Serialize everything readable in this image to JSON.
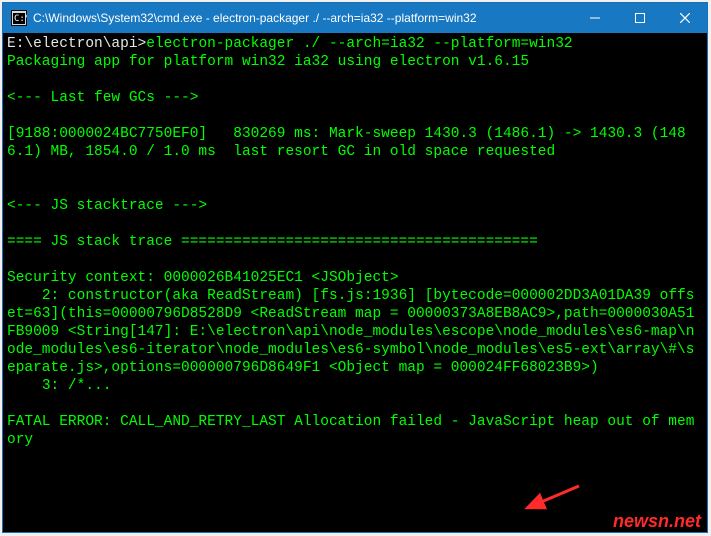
{
  "window": {
    "title": "C:\\Windows\\System32\\cmd.exe - electron-packager  ./  --arch=ia32 --platform=win32"
  },
  "terminal": {
    "prompt_path": "E:\\electron\\api>",
    "command": "electron-packager ./ --arch=ia32 --platform=win32",
    "lines": [
      "Packaging app for platform win32 ia32 using electron v1.6.15",
      "",
      "<--- Last few GCs --->",
      "",
      "[9188:0000024BC7750EF0]   830269 ms: Mark-sweep 1430.3 (1486.1) -> 1430.3 (1486.1) MB, 1854.0 / 1.0 ms  last resort GC in old space requested",
      "",
      "",
      "<--- JS stacktrace --->",
      "",
      "==== JS stack trace =========================================",
      "",
      "Security context: 0000026B41025EC1 <JSObject>",
      "    2: constructor(aka ReadStream) [fs.js:1936] [bytecode=000002DD3A01DA39 offset=63](this=00000796D8528D9 <ReadStream map = 00000373A8EB8AC9>,path=0000030A51FB9009 <String[147]: E:\\electron\\api\\node_modules\\escope\\node_modules\\es6-map\\node_modules\\es6-iterator\\node_modules\\es6-symbol\\node_modules\\es5-ext\\array\\#\\separate.js>,options=000000796D8649F1 <Object map = 000024FF68023B9>)",
      "    3: /*...",
      "",
      "FATAL ERROR: CALL_AND_RETRY_LAST Allocation failed - JavaScript heap out of memory"
    ]
  },
  "watermark": "newsn.net"
}
